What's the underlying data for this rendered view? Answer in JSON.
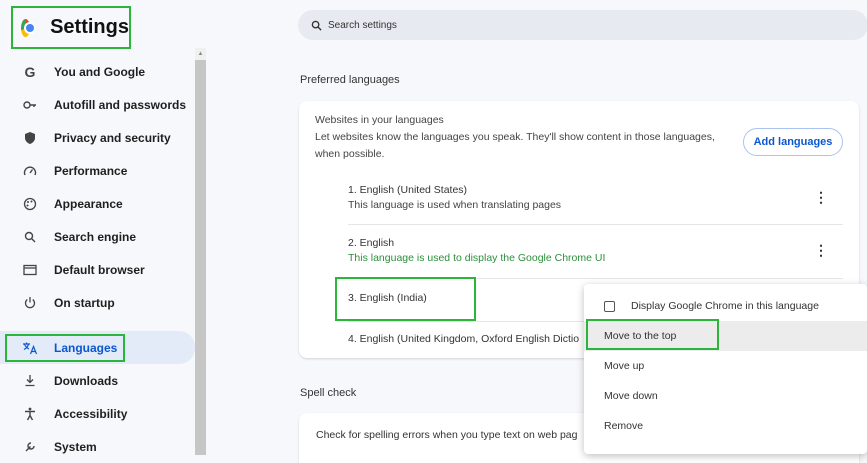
{
  "sidebar": {
    "title": "Settings",
    "items": [
      {
        "label": "You and Google",
        "icon": "google-g-icon"
      },
      {
        "label": "Autofill and passwords",
        "icon": "key-icon"
      },
      {
        "label": "Privacy and security",
        "icon": "shield-icon"
      },
      {
        "label": "Performance",
        "icon": "gauge-icon"
      },
      {
        "label": "Appearance",
        "icon": "palette-icon"
      },
      {
        "label": "Search engine",
        "icon": "search-icon"
      },
      {
        "label": "Default browser",
        "icon": "browser-window-icon"
      },
      {
        "label": "On startup",
        "icon": "power-icon"
      },
      {
        "label": "Languages",
        "icon": "translate-icon",
        "active": true
      },
      {
        "label": "Downloads",
        "icon": "download-icon"
      },
      {
        "label": "Accessibility",
        "icon": "accessibility-icon"
      },
      {
        "label": "System",
        "icon": "wrench-icon"
      }
    ]
  },
  "search": {
    "placeholder": "Search settings"
  },
  "preferred": {
    "title": "Preferred languages",
    "card_title": "Websites in your languages",
    "card_desc": "Let websites know the languages you speak. They'll show content in those languages, when possible.",
    "add_button": "Add languages",
    "languages": [
      {
        "name": "1. English (United States)",
        "sub": "This language is used when translating pages"
      },
      {
        "name": "2. English",
        "sub": "This language is used to display the Google Chrome UI"
      },
      {
        "name": "3. English (India)",
        "sub": ""
      },
      {
        "name": "4. English (United Kingdom, Oxford English Dictio",
        "sub": ""
      }
    ]
  },
  "spell": {
    "title": "Spell check",
    "desc": "Check for spelling errors when you type text on web pag"
  },
  "context_menu": {
    "items": [
      "Display Google Chrome in this language",
      "Move to the top",
      "Move up",
      "Move down",
      "Remove"
    ]
  },
  "colors": {
    "highlight": "#2bb53b",
    "accent": "#0b57d0",
    "green_text": "#2c8f3b"
  }
}
